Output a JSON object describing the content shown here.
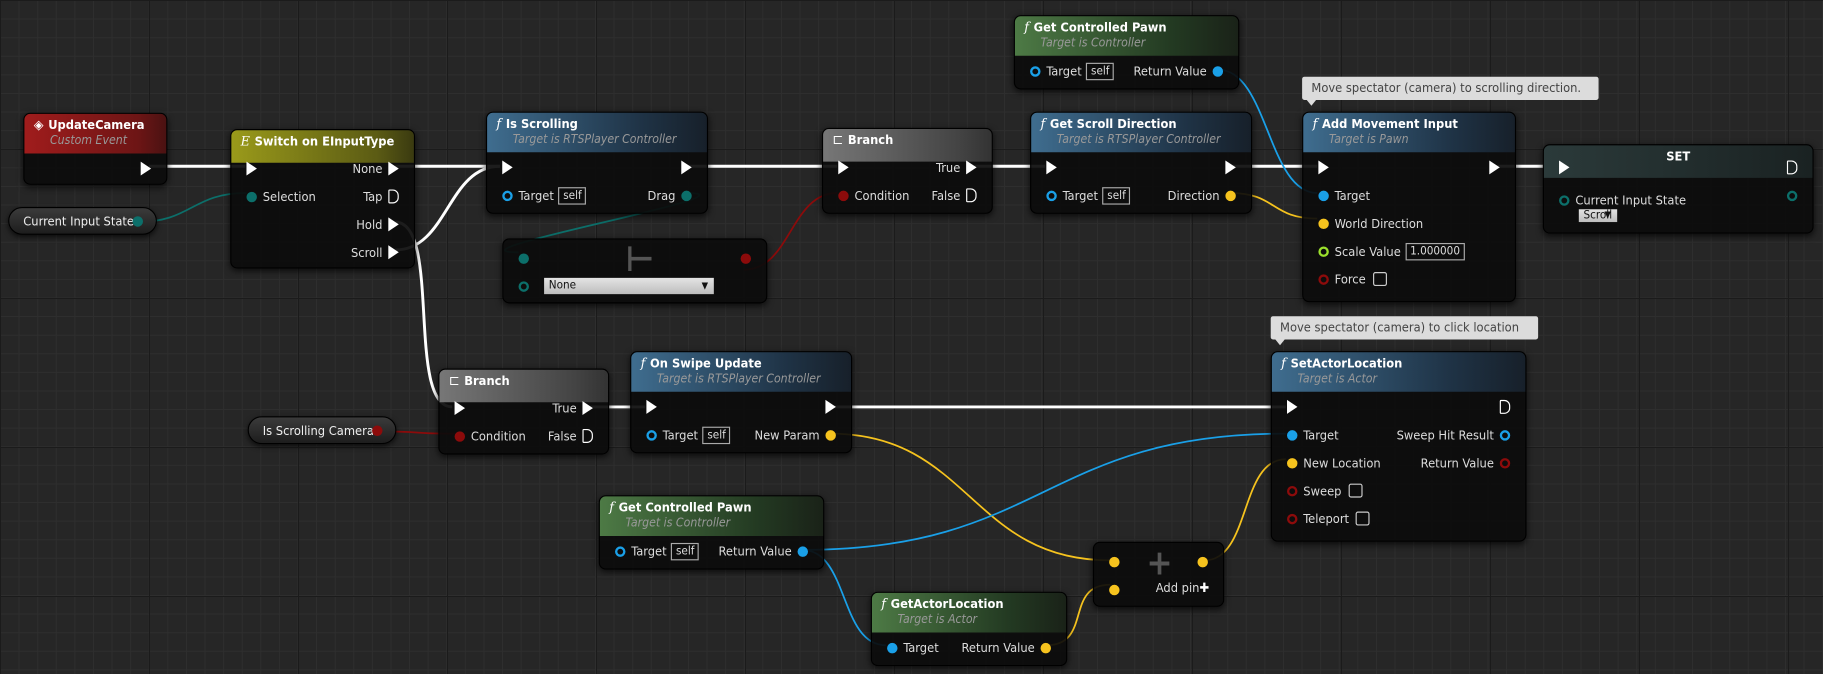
{
  "colors": {
    "exec": "#ffffff",
    "object": "#1aa0e8",
    "vector": "#f6c31e",
    "bool": "#8c0b0b",
    "float": "#9be02c",
    "enum": "#0c6f6a",
    "background": "#262626"
  },
  "variables": [
    {
      "id": "v1",
      "label": "Current Input State",
      "type": "enum"
    },
    {
      "id": "v2",
      "label": "Is Scrolling Camera",
      "type": "bool"
    }
  ],
  "comments": [
    {
      "id": "c1",
      "text": "Move spectator (camera) to scrolling direction."
    },
    {
      "id": "c2",
      "text": "Move spectator (camera) to click location"
    }
  ],
  "nodes": [
    {
      "id": "updateCamera",
      "kind": "event",
      "icon": "event-diamond-icon",
      "title": "UpdateCamera",
      "subtitle": "Custom Event",
      "outputs": [
        {
          "label": "",
          "type": "exec",
          "linked": true
        }
      ]
    },
    {
      "id": "switch",
      "kind": "switch",
      "icon": "switch-icon",
      "title": "Switch on EInputType",
      "inputs": [
        {
          "label": "",
          "type": "exec",
          "linked": true
        },
        {
          "label": "Selection",
          "type": "enum",
          "linked": true
        }
      ],
      "outputs": [
        {
          "label": "None",
          "type": "exec",
          "linked": true
        },
        {
          "label": "Tap",
          "type": "exec",
          "linked": false
        },
        {
          "label": "Hold",
          "type": "exec",
          "linked": true
        },
        {
          "label": "Scroll",
          "type": "exec",
          "linked": true
        }
      ]
    },
    {
      "id": "isScrolling",
      "kind": "func",
      "icon": "function-icon",
      "title": "Is Scrolling",
      "subtitle": "Target is RTSPlayer Controller",
      "inputs": [
        {
          "label": "",
          "type": "exec",
          "linked": true
        },
        {
          "label": "Target",
          "type": "object",
          "linked": false,
          "default": "self"
        }
      ],
      "outputs": [
        {
          "label": "",
          "type": "exec",
          "linked": true
        },
        {
          "label": "Drag",
          "type": "enum",
          "linked": true
        }
      ]
    },
    {
      "id": "enumEq",
      "kind": "compare",
      "title": "",
      "inputs": [
        {
          "label": "",
          "type": "enum",
          "linked": true
        },
        {
          "label": "",
          "type": "enum",
          "linked": false,
          "combo": "None"
        }
      ],
      "outputs": [
        {
          "label": "",
          "type": "bool",
          "linked": true
        }
      ]
    },
    {
      "id": "branch1",
      "kind": "branch",
      "icon": "branch-icon",
      "title": "Branch",
      "inputs": [
        {
          "label": "",
          "type": "exec",
          "linked": true
        },
        {
          "label": "Condition",
          "type": "bool",
          "linked": true
        }
      ],
      "outputs": [
        {
          "label": "True",
          "type": "exec",
          "linked": true
        },
        {
          "label": "False",
          "type": "exec",
          "linked": false
        }
      ]
    },
    {
      "id": "gcp1",
      "kind": "pure",
      "icon": "function-icon",
      "title": "Get Controlled Pawn",
      "subtitle": "Target is Controller",
      "inputs": [
        {
          "label": "Target",
          "type": "object",
          "linked": false,
          "default": "self"
        }
      ],
      "outputs": [
        {
          "label": "Return Value",
          "type": "object",
          "linked": true
        }
      ]
    },
    {
      "id": "gsd",
      "kind": "func",
      "icon": "function-icon",
      "title": "Get Scroll Direction",
      "subtitle": "Target is RTSPlayer Controller",
      "inputs": [
        {
          "label": "",
          "type": "exec",
          "linked": true
        },
        {
          "label": "Target",
          "type": "object",
          "linked": false,
          "default": "self"
        }
      ],
      "outputs": [
        {
          "label": "",
          "type": "exec",
          "linked": true
        },
        {
          "label": "Direction",
          "type": "vector",
          "linked": true
        }
      ]
    },
    {
      "id": "ami",
      "kind": "func",
      "icon": "function-icon",
      "title": "Add Movement Input",
      "subtitle": "Target is Pawn",
      "inputs": [
        {
          "label": "",
          "type": "exec",
          "linked": true
        },
        {
          "label": "Target",
          "type": "object",
          "linked": true
        },
        {
          "label": "World Direction",
          "type": "vector",
          "linked": true
        },
        {
          "label": "Scale Value",
          "type": "float",
          "linked": false,
          "value": "1.000000"
        },
        {
          "label": "Force",
          "type": "bool",
          "linked": false,
          "checkbox": false
        }
      ],
      "outputs": [
        {
          "label": "",
          "type": "exec",
          "linked": true
        }
      ]
    },
    {
      "id": "set",
      "kind": "set",
      "title": "SET",
      "inputs": [
        {
          "label": "",
          "type": "exec",
          "linked": true
        },
        {
          "label": "Current Input State",
          "type": "enum",
          "linked": false,
          "combo": "Scroll"
        }
      ],
      "outputs": [
        {
          "label": "",
          "type": "exec",
          "linked": false
        },
        {
          "label": "",
          "type": "enum",
          "linked": false
        }
      ]
    },
    {
      "id": "branch2",
      "kind": "branch",
      "icon": "branch-icon",
      "title": "Branch",
      "inputs": [
        {
          "label": "",
          "type": "exec",
          "linked": true
        },
        {
          "label": "Condition",
          "type": "bool",
          "linked": true
        }
      ],
      "outputs": [
        {
          "label": "True",
          "type": "exec",
          "linked": true
        },
        {
          "label": "False",
          "type": "exec",
          "linked": false
        }
      ]
    },
    {
      "id": "osu",
      "kind": "func",
      "icon": "function-icon",
      "title": "On Swipe Update",
      "subtitle": "Target is RTSPlayer Controller",
      "inputs": [
        {
          "label": "",
          "type": "exec",
          "linked": true
        },
        {
          "label": "Target",
          "type": "object",
          "linked": false,
          "default": "self"
        }
      ],
      "outputs": [
        {
          "label": "",
          "type": "exec",
          "linked": true
        },
        {
          "label": "New Param",
          "type": "vector",
          "linked": true
        }
      ]
    },
    {
      "id": "sal",
      "kind": "func",
      "icon": "function-icon",
      "title": "SetActorLocation",
      "subtitle": "Target is Actor",
      "inputs": [
        {
          "label": "",
          "type": "exec",
          "linked": true
        },
        {
          "label": "Target",
          "type": "object",
          "linked": true
        },
        {
          "label": "New Location",
          "type": "vector",
          "linked": true
        },
        {
          "label": "Sweep",
          "type": "bool",
          "linked": false,
          "checkbox": false
        },
        {
          "label": "Teleport",
          "type": "bool",
          "linked": false,
          "checkbox": false
        }
      ],
      "outputs": [
        {
          "label": "",
          "type": "exec",
          "linked": false
        },
        {
          "label": "Sweep Hit Result",
          "type": "object",
          "linked": false
        },
        {
          "label": "Return Value",
          "type": "bool",
          "linked": false
        }
      ]
    },
    {
      "id": "gcp2",
      "kind": "pure",
      "icon": "function-icon",
      "title": "Get Controlled Pawn",
      "subtitle": "Target is Controller",
      "inputs": [
        {
          "label": "Target",
          "type": "object",
          "linked": false,
          "default": "self"
        }
      ],
      "outputs": [
        {
          "label": "Return Value",
          "type": "object",
          "linked": true
        }
      ]
    },
    {
      "id": "gal",
      "kind": "pure",
      "icon": "function-icon",
      "title": "GetActorLocation",
      "subtitle": "Target is Actor",
      "inputs": [
        {
          "label": "Target",
          "type": "object",
          "linked": true
        }
      ],
      "outputs": [
        {
          "label": "Return Value",
          "type": "vector",
          "linked": true
        }
      ]
    },
    {
      "id": "add",
      "kind": "compare",
      "title": "",
      "inputs": [
        {
          "label": "",
          "type": "vector",
          "linked": true
        },
        {
          "label": "",
          "type": "vector",
          "linked": true
        }
      ],
      "outputs": [
        {
          "label": "Add pin",
          "type": "addpin"
        },
        {
          "label": "",
          "type": "vector",
          "linked": true
        }
      ]
    }
  ]
}
